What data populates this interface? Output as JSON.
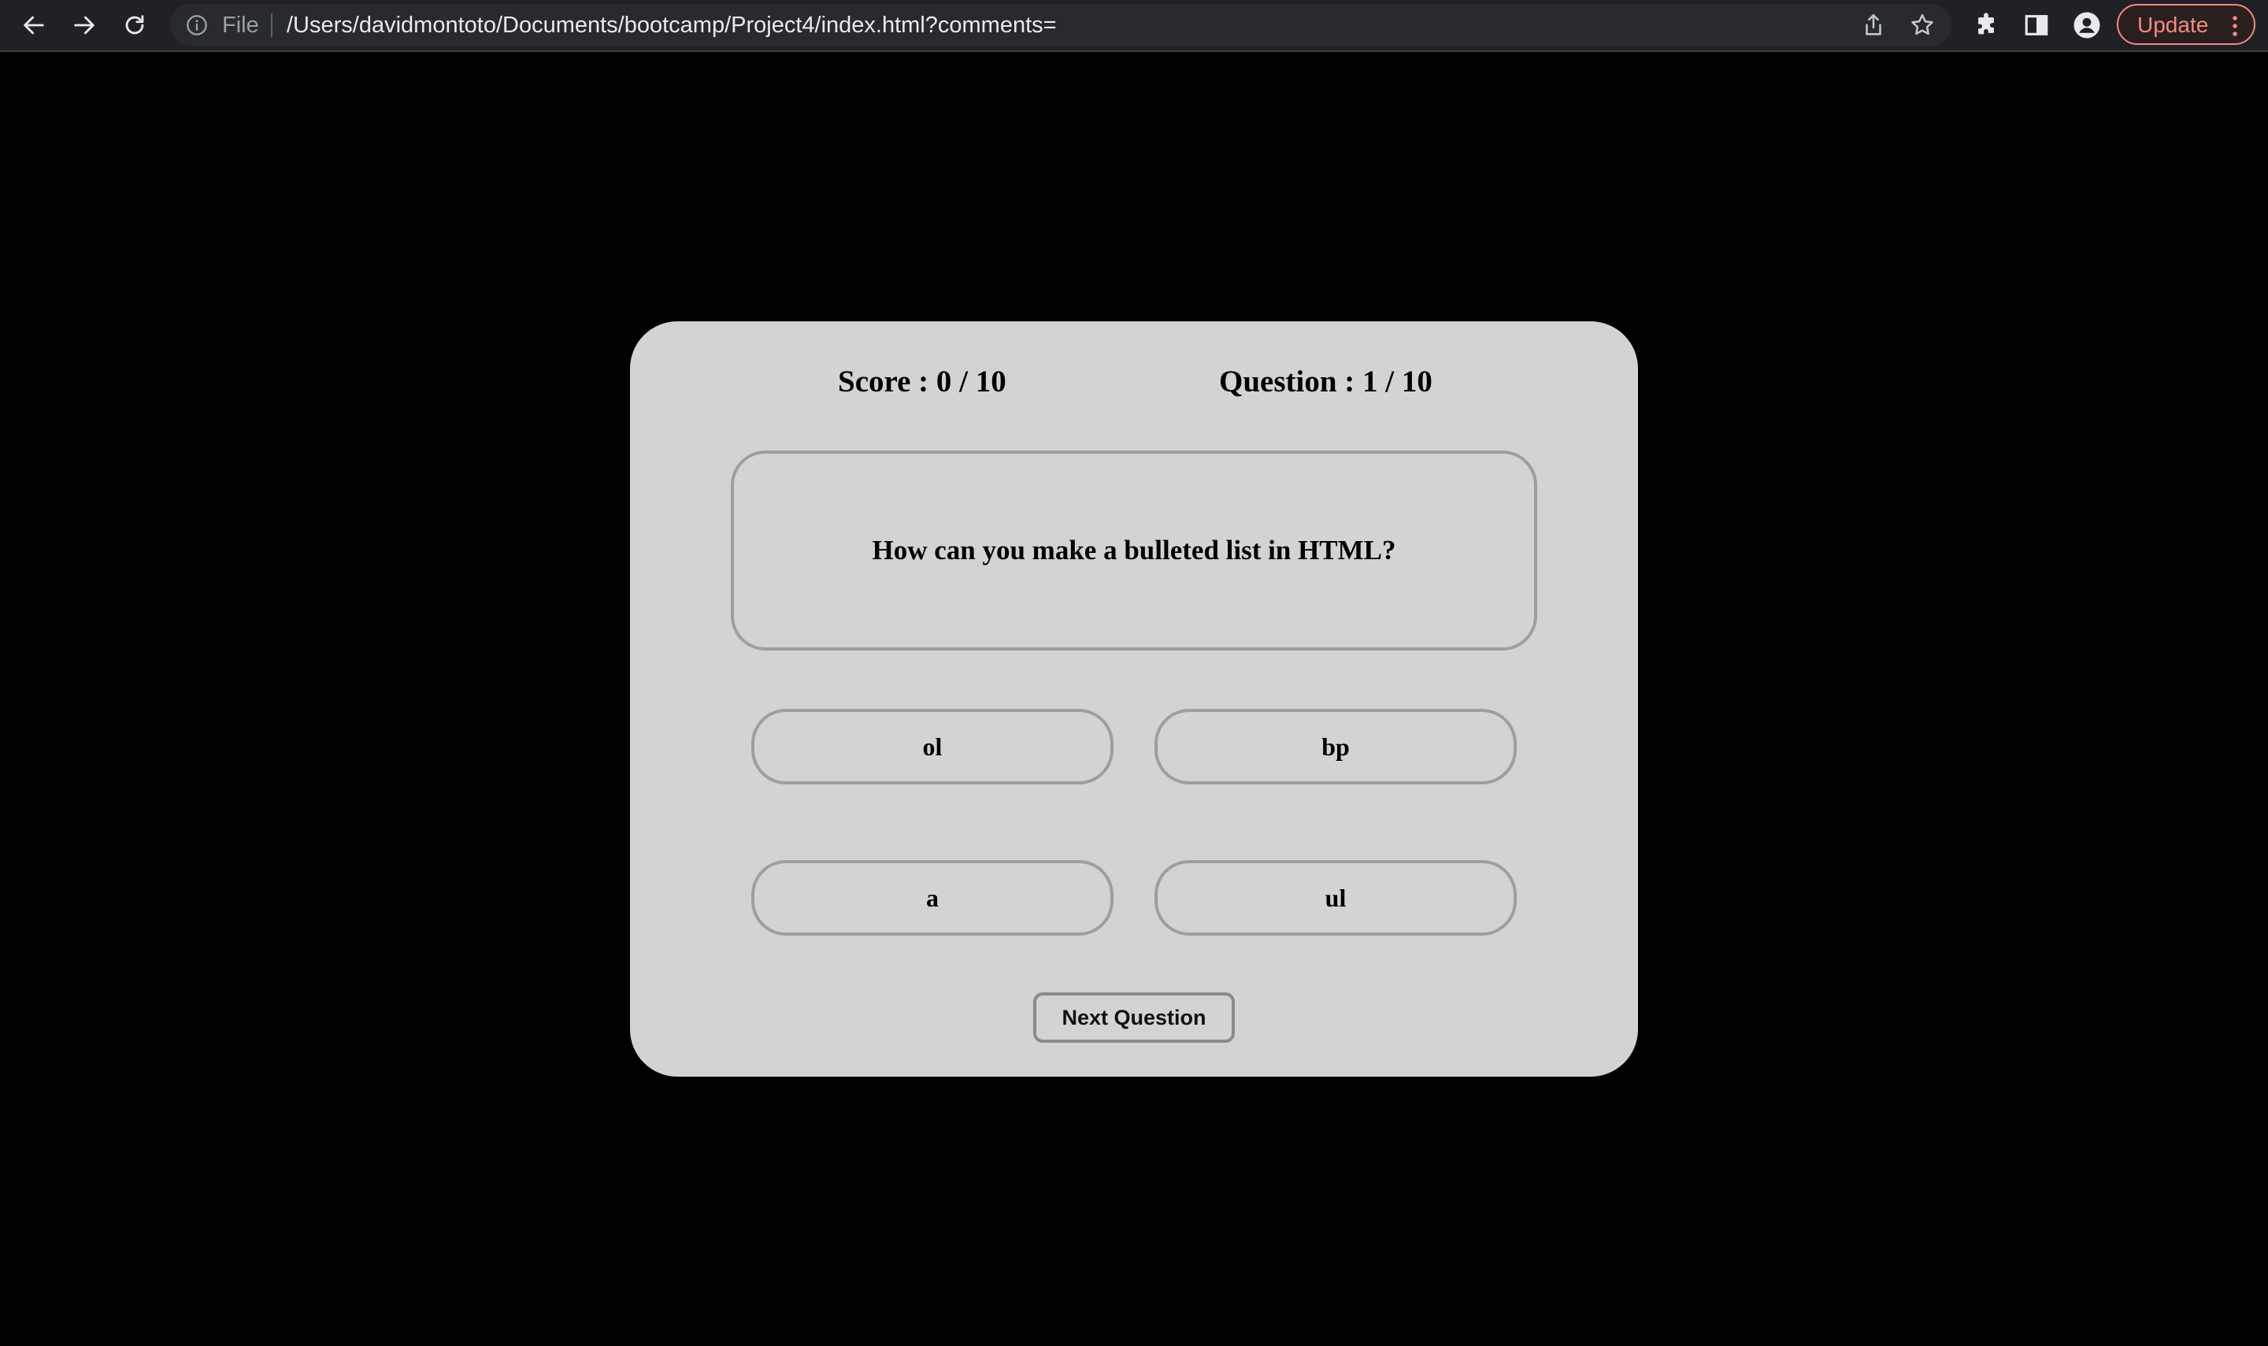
{
  "browser": {
    "url_scheme": "File",
    "url": "/Users/davidmontoto/Documents/bootcamp/Project4/index.html?comments=",
    "update_label": "Update",
    "colors": {
      "toolbar_bg": "#202124",
      "omnibox_bg": "#282a2d",
      "update_accent": "#f28b82"
    }
  },
  "quiz": {
    "score_label": "Score : 0 / 10",
    "question_counter": "Question : 1 / 10",
    "question": "How can you make a bulleted list in HTML?",
    "answers": [
      "ol",
      "bp",
      "a",
      "ul"
    ],
    "next_label": "Next Question",
    "colors": {
      "page_bg": "#000000",
      "card_bg": "#d3d3d3",
      "border": "#9e9e9e"
    }
  }
}
